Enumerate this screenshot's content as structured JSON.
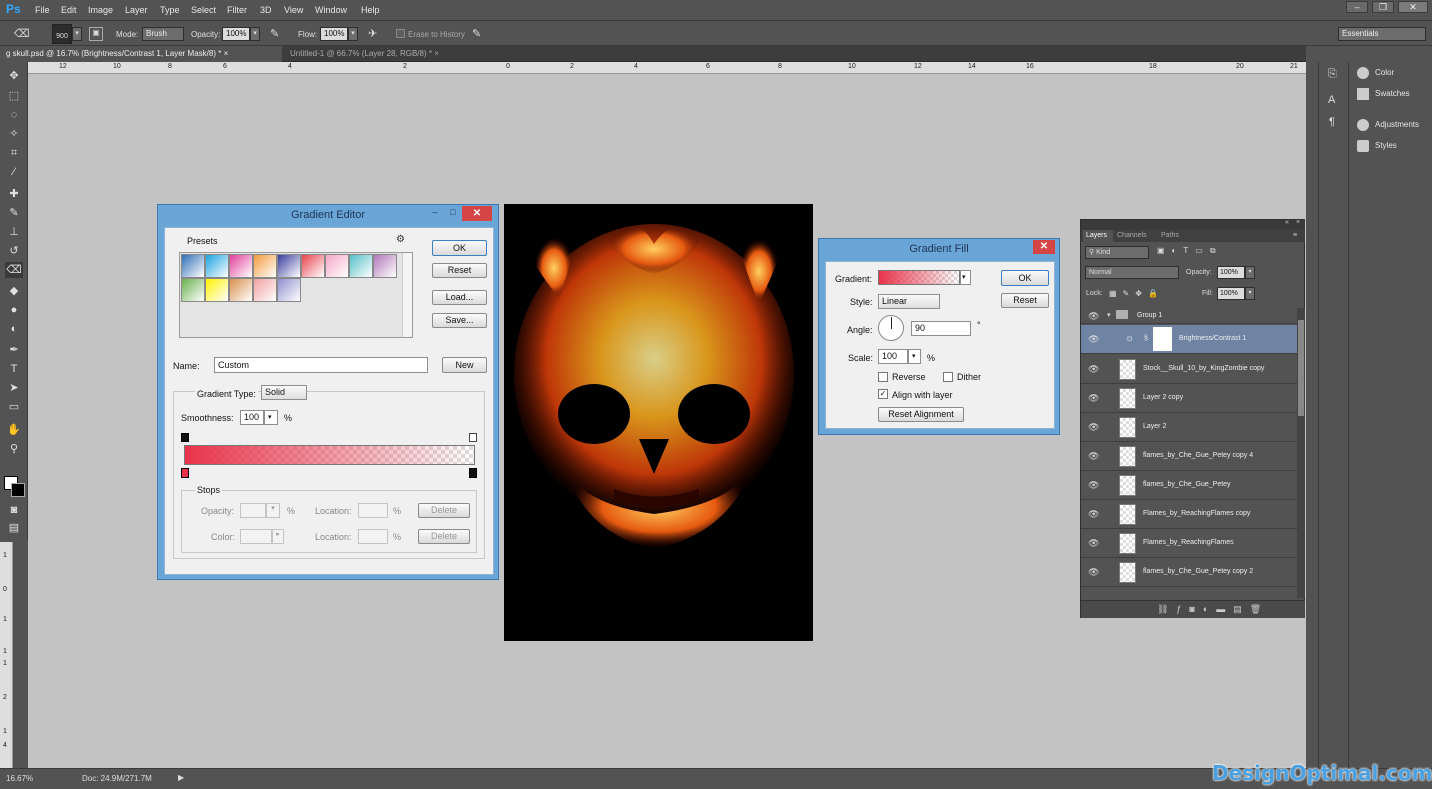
{
  "app": {
    "logo": "Ps"
  },
  "menu": [
    "File",
    "Edit",
    "Image",
    "Layer",
    "Type",
    "Select",
    "Filter",
    "3D",
    "View",
    "Window",
    "Help"
  ],
  "options": {
    "brush_size": "900",
    "mode_label": "Mode:",
    "mode_value": "Brush",
    "opacity_label": "Opacity:",
    "opacity_value": "100%",
    "flow_label": "Flow:",
    "flow_value": "100%",
    "erase_history_label": "Erase to History",
    "workspace": "Essentials"
  },
  "tabs": [
    {
      "label": "g skull.psd @ 16.7% (Brightness/Contrast 1, Layer Mask/8) *",
      "active": true
    },
    {
      "label": "Untitled-1 @ 66.7% (Layer 28, RGB/8) *",
      "active": false
    }
  ],
  "ruler": {
    "top": [
      "12",
      "10",
      "8",
      "6",
      "4",
      "2",
      "0",
      "2",
      "4",
      "6",
      "8",
      "10",
      "12",
      "14",
      "16",
      "18",
      "20",
      "21"
    ],
    "left": [
      "1",
      "0",
      "1",
      "1",
      "1",
      "2",
      "1",
      "4"
    ]
  },
  "dock": {
    "items": [
      "Color",
      "Swatches",
      "Adjustments",
      "Styles"
    ]
  },
  "status": {
    "zoom": "16.67%",
    "doc": "Doc: 24.9M/271.7M"
  },
  "watermark": "DesignOptimal.com",
  "gradient_editor": {
    "title": "Gradient Editor",
    "presets_label": "Presets",
    "ok": "OK",
    "reset": "Reset",
    "load": "Load...",
    "save": "Save...",
    "name_label": "Name:",
    "name_value": "Custom",
    "new": "New",
    "type_label": "Gradient Type:",
    "type_value": "Solid",
    "smoothness_label": "Smoothness:",
    "smoothness_value": "100",
    "pct": "%",
    "stops_label": "Stops",
    "opacity_label": "Opacity:",
    "location_label": "Location:",
    "color_label": "Color:",
    "delete": "Delete",
    "preset_colors": [
      "#2f6fb5",
      "#1aa3e0",
      "#e0409a",
      "#f39a3d",
      "#3a3f9e",
      "#e8444f",
      "#f4a7c4",
      "#54c0c8",
      "#b277b9",
      "#6ab04c",
      "#fff200",
      "#d98f4b",
      "#f2a0a0",
      "#8f8fd0"
    ],
    "gradient_start": "#e8334a"
  },
  "gradient_fill": {
    "title": "Gradient Fill",
    "gradient_label": "Gradient:",
    "style_label": "Style:",
    "style_value": "Linear",
    "angle_label": "Angle:",
    "angle_value": "90",
    "degree": "°",
    "scale_label": "Scale:",
    "scale_value": "100",
    "pct": "%",
    "reverse": "Reverse",
    "dither": "Dither",
    "align": "Align with layer",
    "reset_alignment": "Reset Alignment",
    "ok": "OK",
    "reset": "Reset"
  },
  "layers": {
    "tabs": [
      "Layers",
      "Channels",
      "Paths"
    ],
    "kind": "Kind",
    "blend": "Normal",
    "opacity_label": "Opacity:",
    "opacity_value": "100%",
    "lock_label": "Lock:",
    "fill_label": "Fill:",
    "fill_value": "100%",
    "group": "Group 1",
    "rows": [
      "Brightness/Contrast 1",
      "Stock__Skull_10_by_KingZombie copy",
      "Layer 2 copy",
      "Layer 2",
      "flames_by_Che_Gue_Petey copy 4",
      "flames_by_Che_Gue_Petey",
      "Flames_by_ReachingFlames copy",
      "Flames_by_ReachingFlames",
      "flames_by_Che_Gue_Petey copy 2"
    ]
  }
}
